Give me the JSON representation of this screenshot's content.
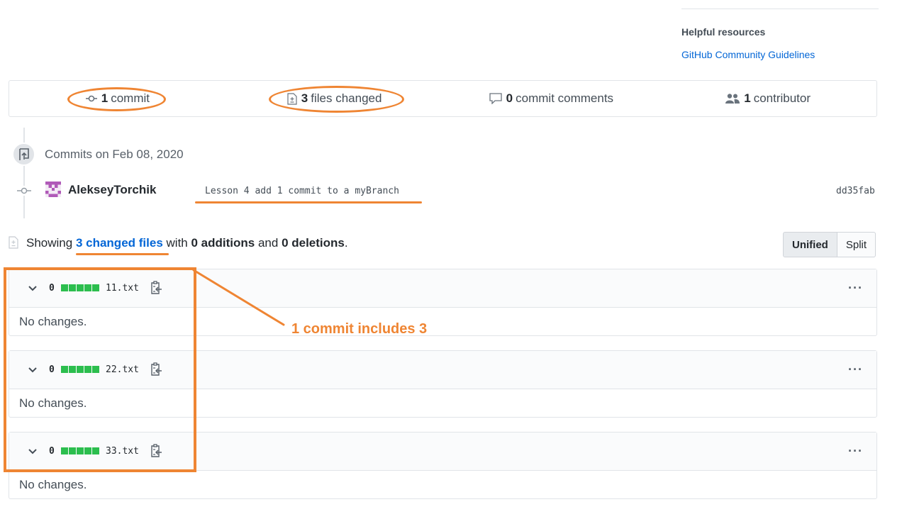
{
  "sidebar": {
    "title": "Helpful resources",
    "link": "GitHub Community Guidelines"
  },
  "stats": {
    "commits": {
      "count": "1",
      "label": "commit",
      "icon": "commit-icon"
    },
    "files": {
      "count": "3",
      "label": "files changed",
      "icon": "file-diff-icon"
    },
    "comments": {
      "count": "0",
      "label": "commit comments",
      "icon": "comment-icon"
    },
    "contributors": {
      "count": "1",
      "label": "contributor",
      "icon": "people-icon"
    }
  },
  "timeline": {
    "date_label": "Commits on Feb 08, 2020",
    "commit": {
      "author": "AlekseyTorchik",
      "message": "Lesson 4 add 1 commit to a myBranch",
      "sha": "dd35fab"
    }
  },
  "summary": {
    "prefix": "Showing",
    "files_link": "3 changed files",
    "with": "with",
    "additions": "0 additions",
    "and": "and",
    "deletions": "0 deletions",
    "period": "."
  },
  "view_toggle": {
    "unified": "Unified",
    "split": "Split",
    "selected": "Unified"
  },
  "files": [
    {
      "changes": "0",
      "name": "11.txt",
      "body": "No changes."
    },
    {
      "changes": "0",
      "name": "22.txt",
      "body": "No changes."
    },
    {
      "changes": "0",
      "name": "33.txt",
      "body": "No changes."
    }
  ],
  "annotation": {
    "text": "1 commit includes 3",
    "color": "#ef8533"
  },
  "colors": {
    "link": "#0366d6",
    "addition_bar": "#2cbe4e",
    "annotation": "#ef8533"
  }
}
